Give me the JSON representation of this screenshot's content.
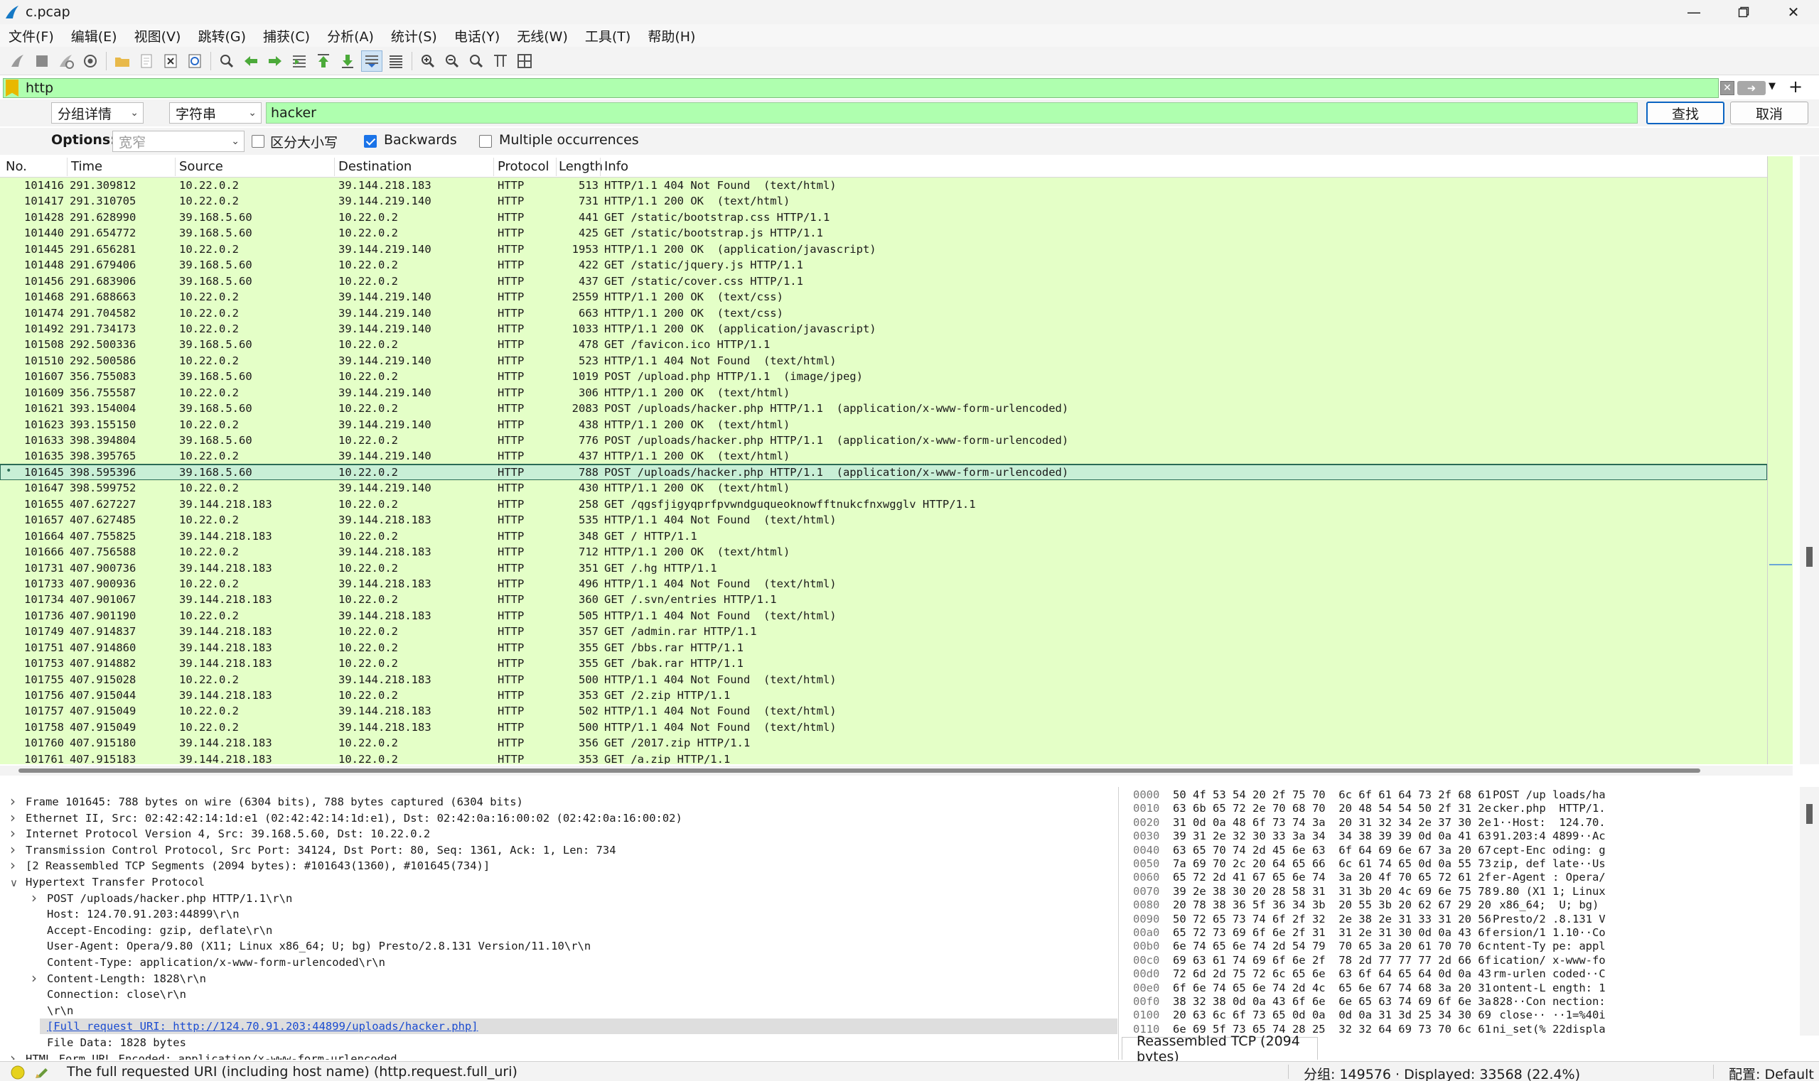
{
  "window": {
    "title": "c.pcap"
  },
  "menu": [
    "文件(F)",
    "编辑(E)",
    "视图(V)",
    "跳转(G)",
    "捕获(C)",
    "分析(A)",
    "统计(S)",
    "电话(Y)",
    "无线(W)",
    "工具(T)",
    "帮助(H)"
  ],
  "filter": {
    "value": "http",
    "add_label": "+"
  },
  "find": {
    "search_in": "分组详情",
    "search_type": "字符串",
    "query": "hacker",
    "find_label": "查找",
    "cancel_label": "取消",
    "options_label": "Options:",
    "charset": "宽窄",
    "case_label": "区分大小写",
    "backwards_label": "Backwards",
    "multiple_label": "Multiple occurrences"
  },
  "columns": {
    "no": "No.",
    "time": "Time",
    "source": "Source",
    "destination": "Destination",
    "protocol": "Protocol",
    "length": "Length",
    "info": "Info"
  },
  "packets": [
    {
      "no": "101416",
      "time": "291.309812",
      "src": "10.22.0.2",
      "dst": "39.144.218.183",
      "proto": "HTTP",
      "len": "513",
      "info": "HTTP/1.1 404 Not Found  (text/html)"
    },
    {
      "no": "101417",
      "time": "291.310705",
      "src": "10.22.0.2",
      "dst": "39.144.219.140",
      "proto": "HTTP",
      "len": "731",
      "info": "HTTP/1.1 200 OK  (text/html)"
    },
    {
      "no": "101428",
      "time": "291.628990",
      "src": "39.168.5.60",
      "dst": "10.22.0.2",
      "proto": "HTTP",
      "len": "441",
      "info": "GET /static/bootstrap.css HTTP/1.1"
    },
    {
      "no": "101440",
      "time": "291.654772",
      "src": "39.168.5.60",
      "dst": "10.22.0.2",
      "proto": "HTTP",
      "len": "425",
      "info": "GET /static/bootstrap.js HTTP/1.1"
    },
    {
      "no": "101445",
      "time": "291.656281",
      "src": "10.22.0.2",
      "dst": "39.144.219.140",
      "proto": "HTTP",
      "len": "1953",
      "info": "HTTP/1.1 200 OK  (application/javascript)"
    },
    {
      "no": "101448",
      "time": "291.679406",
      "src": "39.168.5.60",
      "dst": "10.22.0.2",
      "proto": "HTTP",
      "len": "422",
      "info": "GET /static/jquery.js HTTP/1.1"
    },
    {
      "no": "101456",
      "time": "291.683906",
      "src": "39.168.5.60",
      "dst": "10.22.0.2",
      "proto": "HTTP",
      "len": "437",
      "info": "GET /static/cover.css HTTP/1.1"
    },
    {
      "no": "101468",
      "time": "291.688663",
      "src": "10.22.0.2",
      "dst": "39.144.219.140",
      "proto": "HTTP",
      "len": "2559",
      "info": "HTTP/1.1 200 OK  (text/css)"
    },
    {
      "no": "101474",
      "time": "291.704582",
      "src": "10.22.0.2",
      "dst": "39.144.219.140",
      "proto": "HTTP",
      "len": "663",
      "info": "HTTP/1.1 200 OK  (text/css)"
    },
    {
      "no": "101492",
      "time": "291.734173",
      "src": "10.22.0.2",
      "dst": "39.144.219.140",
      "proto": "HTTP",
      "len": "1033",
      "info": "HTTP/1.1 200 OK  (application/javascript)"
    },
    {
      "no": "101508",
      "time": "292.500336",
      "src": "39.168.5.60",
      "dst": "10.22.0.2",
      "proto": "HTTP",
      "len": "478",
      "info": "GET /favicon.ico HTTP/1.1"
    },
    {
      "no": "101510",
      "time": "292.500586",
      "src": "10.22.0.2",
      "dst": "39.144.219.140",
      "proto": "HTTP",
      "len": "523",
      "info": "HTTP/1.1 404 Not Found  (text/html)"
    },
    {
      "no": "101607",
      "time": "356.755083",
      "src": "39.168.5.60",
      "dst": "10.22.0.2",
      "proto": "HTTP",
      "len": "1019",
      "info": "POST /upload.php HTTP/1.1  (image/jpeg)"
    },
    {
      "no": "101609",
      "time": "356.755587",
      "src": "10.22.0.2",
      "dst": "39.144.219.140",
      "proto": "HTTP",
      "len": "306",
      "info": "HTTP/1.1 200 OK  (text/html)"
    },
    {
      "no": "101621",
      "time": "393.154004",
      "src": "39.168.5.60",
      "dst": "10.22.0.2",
      "proto": "HTTP",
      "len": "2083",
      "info": "POST /uploads/hacker.php HTTP/1.1  (application/x-www-form-urlencoded)"
    },
    {
      "no": "101623",
      "time": "393.155150",
      "src": "10.22.0.2",
      "dst": "39.144.219.140",
      "proto": "HTTP",
      "len": "438",
      "info": "HTTP/1.1 200 OK  (text/html)"
    },
    {
      "no": "101633",
      "time": "398.394804",
      "src": "39.168.5.60",
      "dst": "10.22.0.2",
      "proto": "HTTP",
      "len": "776",
      "info": "POST /uploads/hacker.php HTTP/1.1  (application/x-www-form-urlencoded)"
    },
    {
      "no": "101635",
      "time": "398.395765",
      "src": "10.22.0.2",
      "dst": "39.144.219.140",
      "proto": "HTTP",
      "len": "437",
      "info": "HTTP/1.1 200 OK  (text/html)"
    },
    {
      "no": "101645",
      "time": "398.595396",
      "src": "39.168.5.60",
      "dst": "10.22.0.2",
      "proto": "HTTP",
      "len": "788",
      "info": "POST /uploads/hacker.php HTTP/1.1  (application/x-www-form-urlencoded)",
      "selected": true
    },
    {
      "no": "101647",
      "time": "398.599752",
      "src": "10.22.0.2",
      "dst": "39.144.219.140",
      "proto": "HTTP",
      "len": "430",
      "info": "HTTP/1.1 200 OK  (text/html)"
    },
    {
      "no": "101655",
      "time": "407.627227",
      "src": "39.144.218.183",
      "dst": "10.22.0.2",
      "proto": "HTTP",
      "len": "258",
      "info": "GET /qgsfjigyqprfpvwndguqueoknowfftnukcfnxwgglv HTTP/1.1"
    },
    {
      "no": "101657",
      "time": "407.627485",
      "src": "10.22.0.2",
      "dst": "39.144.218.183",
      "proto": "HTTP",
      "len": "535",
      "info": "HTTP/1.1 404 Not Found  (text/html)"
    },
    {
      "no": "101664",
      "time": "407.755825",
      "src": "39.144.218.183",
      "dst": "10.22.0.2",
      "proto": "HTTP",
      "len": "348",
      "info": "GET / HTTP/1.1"
    },
    {
      "no": "101666",
      "time": "407.756588",
      "src": "10.22.0.2",
      "dst": "39.144.218.183",
      "proto": "HTTP",
      "len": "712",
      "info": "HTTP/1.1 200 OK  (text/html)"
    },
    {
      "no": "101731",
      "time": "407.900736",
      "src": "39.144.218.183",
      "dst": "10.22.0.2",
      "proto": "HTTP",
      "len": "351",
      "info": "GET /.hg HTTP/1.1"
    },
    {
      "no": "101733",
      "time": "407.900936",
      "src": "10.22.0.2",
      "dst": "39.144.218.183",
      "proto": "HTTP",
      "len": "496",
      "info": "HTTP/1.1 404 Not Found  (text/html)"
    },
    {
      "no": "101734",
      "time": "407.901067",
      "src": "39.144.218.183",
      "dst": "10.22.0.2",
      "proto": "HTTP",
      "len": "360",
      "info": "GET /.svn/entries HTTP/1.1"
    },
    {
      "no": "101736",
      "time": "407.901190",
      "src": "10.22.0.2",
      "dst": "39.144.218.183",
      "proto": "HTTP",
      "len": "505",
      "info": "HTTP/1.1 404 Not Found  (text/html)"
    },
    {
      "no": "101749",
      "time": "407.914837",
      "src": "39.144.218.183",
      "dst": "10.22.0.2",
      "proto": "HTTP",
      "len": "357",
      "info": "GET /admin.rar HTTP/1.1"
    },
    {
      "no": "101751",
      "time": "407.914860",
      "src": "39.144.218.183",
      "dst": "10.22.0.2",
      "proto": "HTTP",
      "len": "355",
      "info": "GET /bbs.rar HTTP/1.1"
    },
    {
      "no": "101753",
      "time": "407.914882",
      "src": "39.144.218.183",
      "dst": "10.22.0.2",
      "proto": "HTTP",
      "len": "355",
      "info": "GET /bak.rar HTTP/1.1"
    },
    {
      "no": "101755",
      "time": "407.915028",
      "src": "10.22.0.2",
      "dst": "39.144.218.183",
      "proto": "HTTP",
      "len": "500",
      "info": "HTTP/1.1 404 Not Found  (text/html)"
    },
    {
      "no": "101756",
      "time": "407.915044",
      "src": "39.144.218.183",
      "dst": "10.22.0.2",
      "proto": "HTTP",
      "len": "353",
      "info": "GET /2.zip HTTP/1.1"
    },
    {
      "no": "101757",
      "time": "407.915049",
      "src": "10.22.0.2",
      "dst": "39.144.218.183",
      "proto": "HTTP",
      "len": "502",
      "info": "HTTP/1.1 404 Not Found  (text/html)"
    },
    {
      "no": "101758",
      "time": "407.915049",
      "src": "10.22.0.2",
      "dst": "39.144.218.183",
      "proto": "HTTP",
      "len": "500",
      "info": "HTTP/1.1 404 Not Found  (text/html)"
    },
    {
      "no": "101760",
      "time": "407.915180",
      "src": "39.144.218.183",
      "dst": "10.22.0.2",
      "proto": "HTTP",
      "len": "356",
      "info": "GET /2017.zip HTTP/1.1"
    },
    {
      "no": "101761",
      "time": "407.915183",
      "src": "39.144.218.183",
      "dst": "10.22.0.2",
      "proto": "HTTP",
      "len": "353",
      "info": "GET /a.zip HTTP/1.1"
    }
  ],
  "details": [
    {
      "text": "Frame 101645: 788 bytes on wire (6304 bits), 788 bytes captured (6304 bits)",
      "indent": 0,
      "toggle": ">"
    },
    {
      "text": "Ethernet II, Src: 02:42:42:14:1d:e1 (02:42:42:14:1d:e1), Dst: 02:42:0a:16:00:02 (02:42:0a:16:00:02)",
      "indent": 0,
      "toggle": ">"
    },
    {
      "text": "Internet Protocol Version 4, Src: 39.168.5.60, Dst: 10.22.0.2",
      "indent": 0,
      "toggle": ">"
    },
    {
      "text": "Transmission Control Protocol, Src Port: 34124, Dst Port: 80, Seq: 1361, Ack: 1, Len: 734",
      "indent": 0,
      "toggle": ">"
    },
    {
      "text": "[2 Reassembled TCP Segments (2094 bytes): #101643(1360), #101645(734)]",
      "indent": 0,
      "toggle": ">"
    },
    {
      "text": "Hypertext Transfer Protocol",
      "indent": 0,
      "toggle": "v"
    },
    {
      "text": "POST /uploads/hacker.php HTTP/1.1\\r\\n",
      "indent": 1,
      "toggle": ">"
    },
    {
      "text": "Host: 124.70.91.203:44899\\r\\n",
      "indent": 1,
      "toggle": ""
    },
    {
      "text": "Accept-Encoding: gzip, deflate\\r\\n",
      "indent": 1,
      "toggle": ""
    },
    {
      "text": "User-Agent: Opera/9.80 (X11; Linux x86_64; U; bg) Presto/2.8.131 Version/11.10\\r\\n",
      "indent": 1,
      "toggle": ""
    },
    {
      "text": "Content-Type: application/x-www-form-urlencoded\\r\\n",
      "indent": 1,
      "toggle": ""
    },
    {
      "text": "Content-Length: 1828\\r\\n",
      "indent": 1,
      "toggle": ">"
    },
    {
      "text": "Connection: close\\r\\n",
      "indent": 1,
      "toggle": ""
    },
    {
      "text": "\\r\\n",
      "indent": 1,
      "toggle": ""
    },
    {
      "text": "[Full request URI: http://124.70.91.203:44899/uploads/hacker.php]",
      "indent": 1,
      "toggle": "",
      "link": true,
      "highlight": true
    },
    {
      "text": "File Data: 1828 bytes",
      "indent": 1,
      "toggle": ""
    },
    {
      "text": "HTML Form URL Encoded: application/x-www-form-urlencoded",
      "indent": 0,
      "toggle": ">"
    }
  ],
  "hex": [
    {
      "off": "0000",
      "bytes": "50 4f 53 54 20 2f 75 70  6c 6f 61 64 73 2f 68 61",
      "ascii": "POST /up loads/ha"
    },
    {
      "off": "0010",
      "bytes": "63 6b 65 72 2e 70 68 70  20 48 54 54 50 2f 31 2e",
      "ascii": "cker.php  HTTP/1."
    },
    {
      "off": "0020",
      "bytes": "31 0d 0a 48 6f 73 74 3a  20 31 32 34 2e 37 30 2e",
      "ascii": "1··Host:  124.70."
    },
    {
      "off": "0030",
      "bytes": "39 31 2e 32 30 33 3a 34  34 38 39 39 0d 0a 41 63",
      "ascii": "91.203:4 4899··Ac"
    },
    {
      "off": "0040",
      "bytes": "63 65 70 74 2d 45 6e 63  6f 64 69 6e 67 3a 20 67",
      "ascii": "cept-Enc oding: g"
    },
    {
      "off": "0050",
      "bytes": "7a 69 70 2c 20 64 65 66  6c 61 74 65 0d 0a 55 73",
      "ascii": "zip, def late··Us"
    },
    {
      "off": "0060",
      "bytes": "65 72 2d 41 67 65 6e 74  3a 20 4f 70 65 72 61 2f",
      "ascii": "er-Agent : Opera/"
    },
    {
      "off": "0070",
      "bytes": "39 2e 38 30 20 28 58 31  31 3b 20 4c 69 6e 75 78",
      "ascii": "9.80 (X1 1; Linux"
    },
    {
      "off": "0080",
      "bytes": "20 78 38 36 5f 36 34 3b  20 55 3b 20 62 67 29 20",
      "ascii": " x86_64;  U; bg) "
    },
    {
      "off": "0090",
      "bytes": "50 72 65 73 74 6f 2f 32  2e 38 2e 31 33 31 20 56",
      "ascii": "Presto/2 .8.131 V"
    },
    {
      "off": "00a0",
      "bytes": "65 72 73 69 6f 6e 2f 31  31 2e 31 30 0d 0a 43 6f",
      "ascii": "ersion/1 1.10··Co"
    },
    {
      "off": "00b0",
      "bytes": "6e 74 65 6e 74 2d 54 79  70 65 3a 20 61 70 70 6c",
      "ascii": "ntent-Ty pe: appl"
    },
    {
      "off": "00c0",
      "bytes": "69 63 61 74 69 6f 6e 2f  78 2d 77 77 77 2d 66 6f",
      "ascii": "ication/ x-www-fo"
    },
    {
      "off": "00d0",
      "bytes": "72 6d 2d 75 72 6c 65 6e  63 6f 64 65 64 0d 0a 43",
      "ascii": "rm-urlen coded··C"
    },
    {
      "off": "00e0",
      "bytes": "6f 6e 74 65 6e 74 2d 4c  65 6e 67 74 68 3a 20 31",
      "ascii": "ontent-L ength: 1"
    },
    {
      "off": "00f0",
      "bytes": "38 32 38 0d 0a 43 6f 6e  6e 65 63 74 69 6f 6e 3a",
      "ascii": "828··Con nection:"
    },
    {
      "off": "0100",
      "bytes": "20 63 6c 6f 73 65 0d 0a  0d 0a 31 3d 25 34 30 69",
      "ascii": " close·· ··1=%40i"
    },
    {
      "off": "0110",
      "bytes": "6e 69 5f 73 65 74 28 25  32 32 64 69 73 70 6c 61",
      "ascii": "ni_set(% 22displa"
    }
  ],
  "hex_tab": "Reassembled TCP (2094 bytes)",
  "status": {
    "field_desc": "The full requested URI (including host name) (http.request.full_uri)",
    "packets": "分组: 149576 · Displayed: 33568 (22.4%)",
    "profile": "配置: Default"
  },
  "colors": {
    "http_row": "#e4ffc7",
    "filter_ok": "#afffaf",
    "selected_outline": "#2b6b55"
  }
}
